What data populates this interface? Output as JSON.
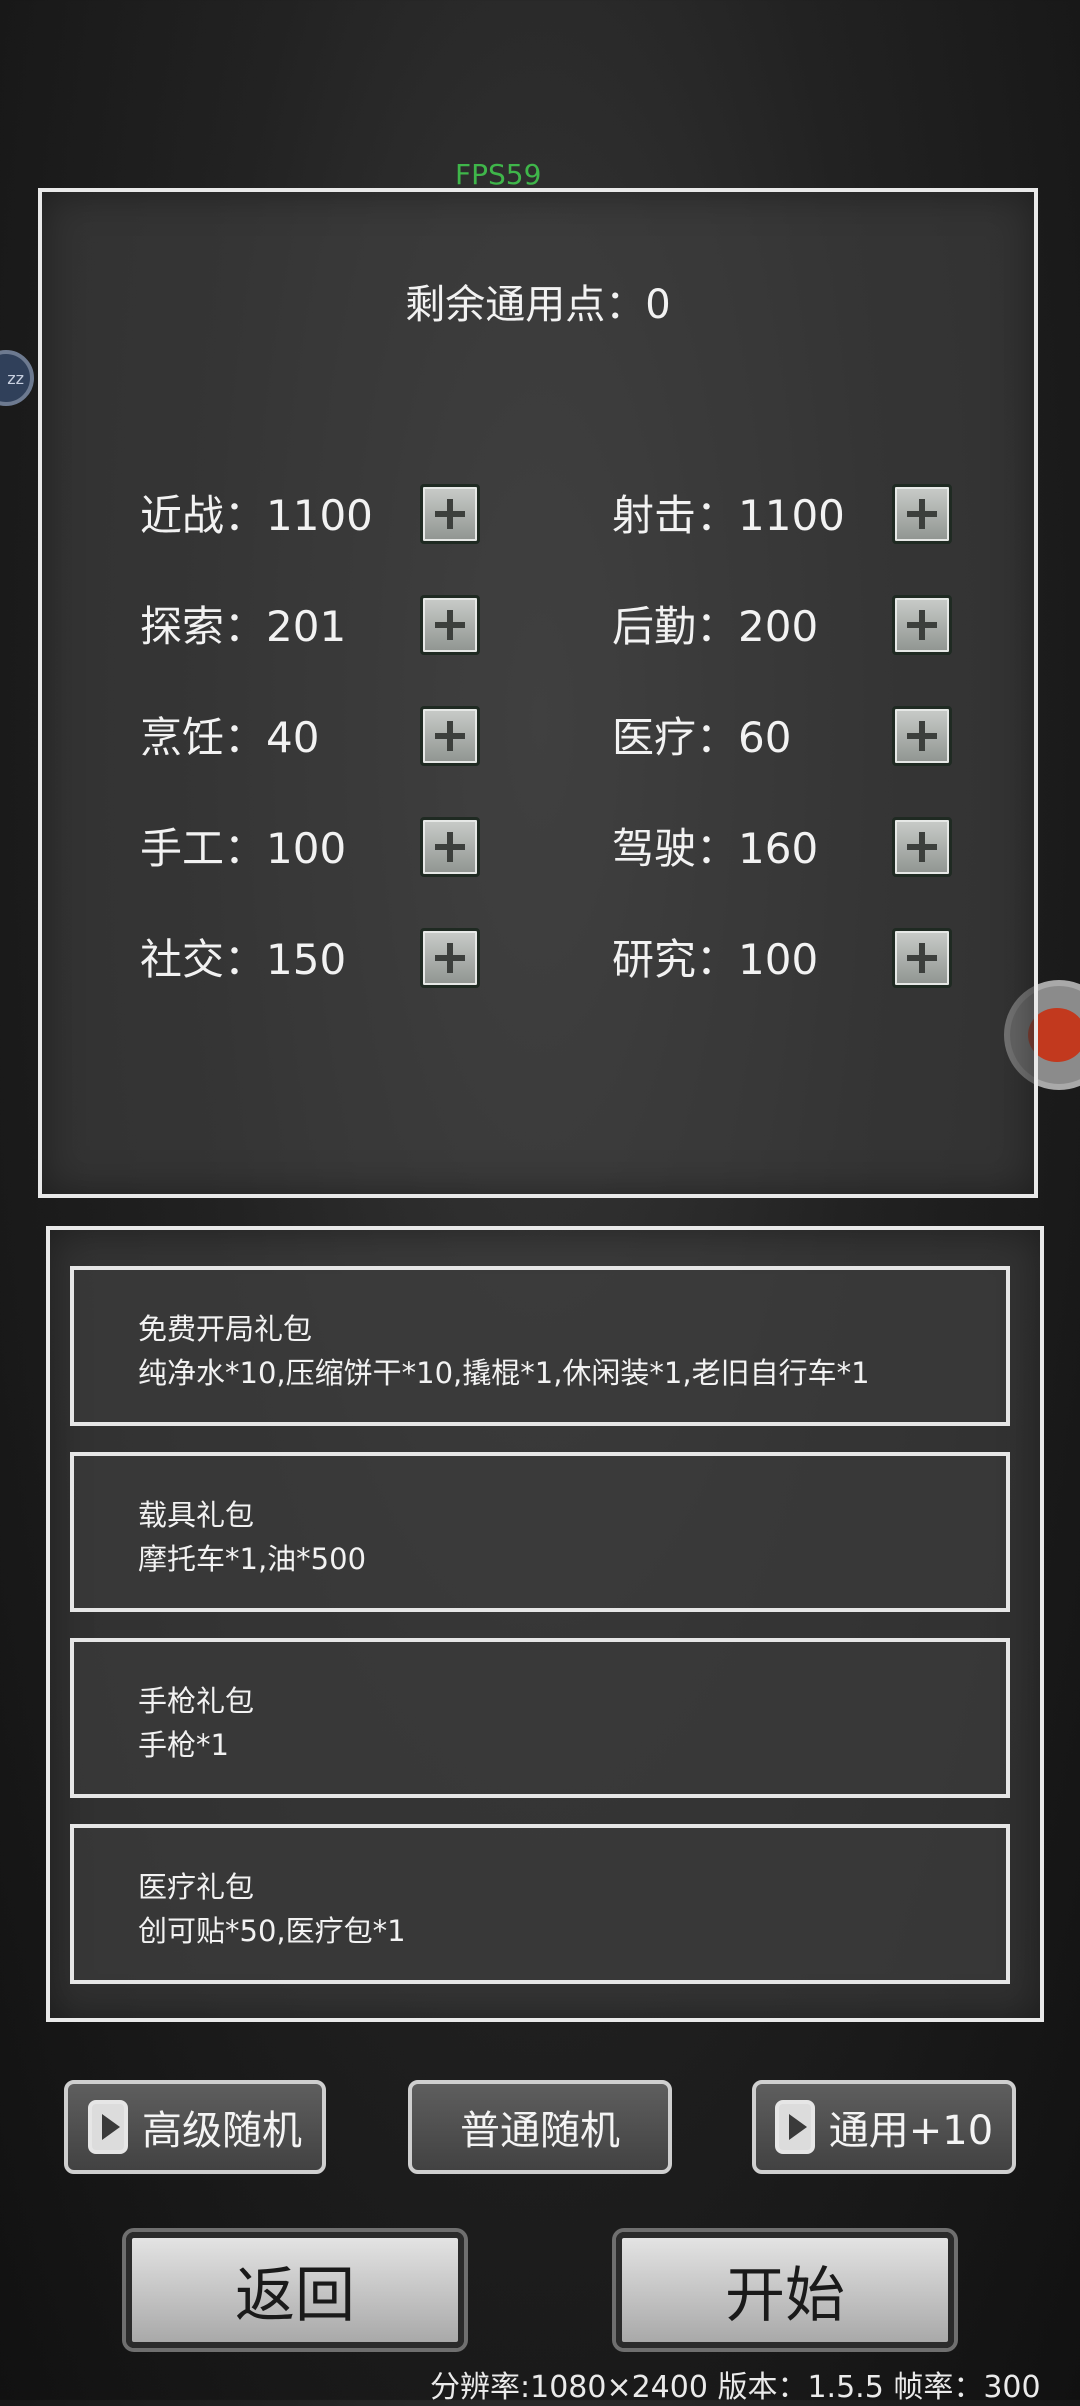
{
  "overlay": {
    "fps": "FPS59",
    "left_bubble": "zz"
  },
  "stats": {
    "points_label": "剩余通用点：0",
    "items": [
      {
        "label": "近战：1100"
      },
      {
        "label": "射击：1100"
      },
      {
        "label": "探索：201"
      },
      {
        "label": "后勤：200"
      },
      {
        "label": "烹饪：40"
      },
      {
        "label": "医疗：60"
      },
      {
        "label": "手工：100"
      },
      {
        "label": "驾驶：160"
      },
      {
        "label": "社交：150"
      },
      {
        "label": "研究：100"
      }
    ]
  },
  "packs": [
    {
      "name": "免费开局礼包",
      "items": "纯净水*10,压缩饼干*10,撬棍*1,休闲装*1,老旧自行车*1"
    },
    {
      "name": "载具礼包",
      "items": "摩托车*1,油*500"
    },
    {
      "name": "手枪礼包",
      "items": "手枪*1"
    },
    {
      "name": "医疗礼包",
      "items": "创可贴*50,医疗包*1"
    }
  ],
  "buttons": {
    "advanced_random": "高级随机",
    "normal_random": "普通随机",
    "general_plus": "通用+10",
    "back": "返回",
    "start": "开始"
  },
  "footer": {
    "info": "分辨率:1080×2400    版本：1.5.5    帧率：300"
  },
  "icons": {
    "add": "plus-icon",
    "video_ad": "play-icon"
  }
}
